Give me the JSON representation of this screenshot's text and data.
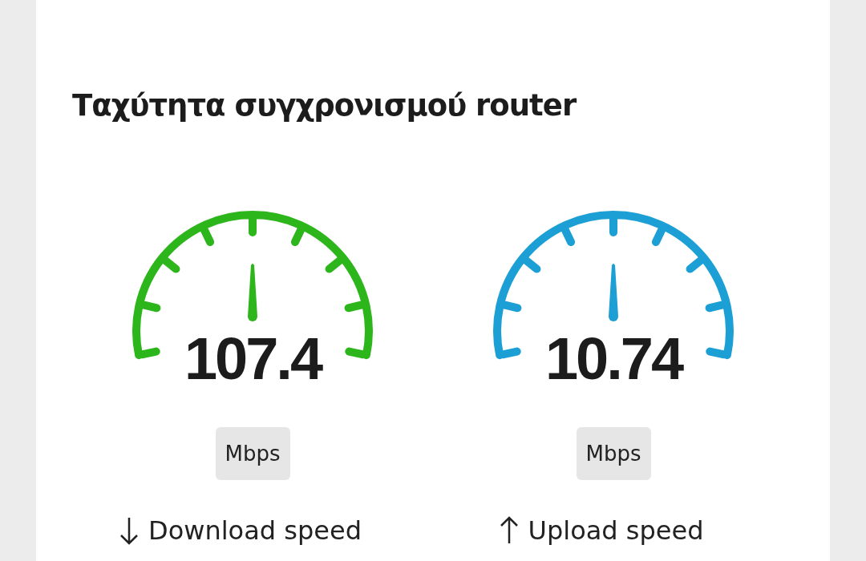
{
  "card": {
    "title": "Ταχύτητα συγχρονισμού router"
  },
  "gauges": [
    {
      "kind": "download",
      "color": "#2db51c",
      "value": "107.4",
      "unit": "Mbps",
      "label": "Download speed"
    },
    {
      "kind": "upload",
      "color": "#1b9fd4",
      "value": "10.74",
      "unit": "Mbps",
      "label": "Upload speed"
    }
  ]
}
